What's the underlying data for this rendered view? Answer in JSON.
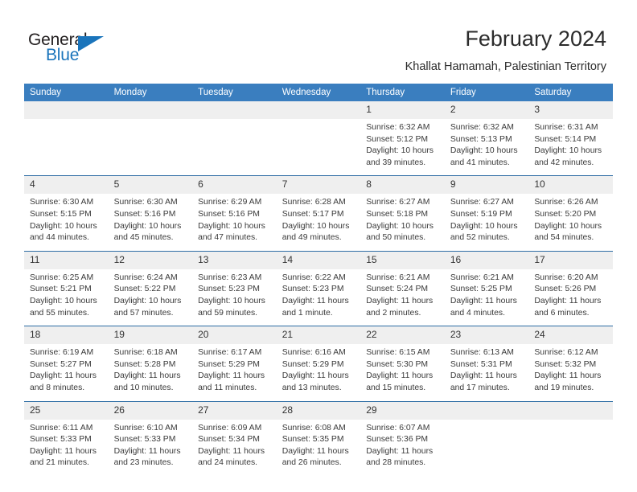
{
  "brand": {
    "name_top": "General",
    "name_bottom": "Blue",
    "triangle_icon": "blue-triangle-icon",
    "color_dark": "#231f20",
    "color_blue": "#1a74bb"
  },
  "header": {
    "month_year": "February 2024",
    "location": "Khallat Hamamah, Palestinian Territory"
  },
  "theme": {
    "header_blue": "#3a7ebf",
    "row_divider_blue": "#2e6da4",
    "daynum_gray": "#efefef",
    "text": "#3a3a3a"
  },
  "weekday_headers": [
    "Sunday",
    "Monday",
    "Tuesday",
    "Wednesday",
    "Thursday",
    "Friday",
    "Saturday"
  ],
  "labels": {
    "sunrise_prefix": "Sunrise:",
    "sunset_prefix": "Sunset:",
    "daylight_prefix": "Daylight:"
  },
  "weeks": [
    [
      {
        "day": "",
        "empty": true,
        "line1": "",
        "line2": "",
        "line3": "",
        "line4": ""
      },
      {
        "day": "",
        "empty": true,
        "line1": "",
        "line2": "",
        "line3": "",
        "line4": ""
      },
      {
        "day": "",
        "empty": true,
        "line1": "",
        "line2": "",
        "line3": "",
        "line4": ""
      },
      {
        "day": "",
        "empty": true,
        "line1": "",
        "line2": "",
        "line3": "",
        "line4": ""
      },
      {
        "day": "1",
        "empty": false,
        "line1": "Sunrise: 6:32 AM",
        "line2": "Sunset: 5:12 PM",
        "line3": "Daylight: 10 hours",
        "line4": "and 39 minutes."
      },
      {
        "day": "2",
        "empty": false,
        "line1": "Sunrise: 6:32 AM",
        "line2": "Sunset: 5:13 PM",
        "line3": "Daylight: 10 hours",
        "line4": "and 41 minutes."
      },
      {
        "day": "3",
        "empty": false,
        "line1": "Sunrise: 6:31 AM",
        "line2": "Sunset: 5:14 PM",
        "line3": "Daylight: 10 hours",
        "line4": "and 42 minutes."
      }
    ],
    [
      {
        "day": "4",
        "empty": false,
        "line1": "Sunrise: 6:30 AM",
        "line2": "Sunset: 5:15 PM",
        "line3": "Daylight: 10 hours",
        "line4": "and 44 minutes."
      },
      {
        "day": "5",
        "empty": false,
        "line1": "Sunrise: 6:30 AM",
        "line2": "Sunset: 5:16 PM",
        "line3": "Daylight: 10 hours",
        "line4": "and 45 minutes."
      },
      {
        "day": "6",
        "empty": false,
        "line1": "Sunrise: 6:29 AM",
        "line2": "Sunset: 5:16 PM",
        "line3": "Daylight: 10 hours",
        "line4": "and 47 minutes."
      },
      {
        "day": "7",
        "empty": false,
        "line1": "Sunrise: 6:28 AM",
        "line2": "Sunset: 5:17 PM",
        "line3": "Daylight: 10 hours",
        "line4": "and 49 minutes."
      },
      {
        "day": "8",
        "empty": false,
        "line1": "Sunrise: 6:27 AM",
        "line2": "Sunset: 5:18 PM",
        "line3": "Daylight: 10 hours",
        "line4": "and 50 minutes."
      },
      {
        "day": "9",
        "empty": false,
        "line1": "Sunrise: 6:27 AM",
        "line2": "Sunset: 5:19 PM",
        "line3": "Daylight: 10 hours",
        "line4": "and 52 minutes."
      },
      {
        "day": "10",
        "empty": false,
        "line1": "Sunrise: 6:26 AM",
        "line2": "Sunset: 5:20 PM",
        "line3": "Daylight: 10 hours",
        "line4": "and 54 minutes."
      }
    ],
    [
      {
        "day": "11",
        "empty": false,
        "line1": "Sunrise: 6:25 AM",
        "line2": "Sunset: 5:21 PM",
        "line3": "Daylight: 10 hours",
        "line4": "and 55 minutes."
      },
      {
        "day": "12",
        "empty": false,
        "line1": "Sunrise: 6:24 AM",
        "line2": "Sunset: 5:22 PM",
        "line3": "Daylight: 10 hours",
        "line4": "and 57 minutes."
      },
      {
        "day": "13",
        "empty": false,
        "line1": "Sunrise: 6:23 AM",
        "line2": "Sunset: 5:23 PM",
        "line3": "Daylight: 10 hours",
        "line4": "and 59 minutes."
      },
      {
        "day": "14",
        "empty": false,
        "line1": "Sunrise: 6:22 AM",
        "line2": "Sunset: 5:23 PM",
        "line3": "Daylight: 11 hours",
        "line4": "and 1 minute."
      },
      {
        "day": "15",
        "empty": false,
        "line1": "Sunrise: 6:21 AM",
        "line2": "Sunset: 5:24 PM",
        "line3": "Daylight: 11 hours",
        "line4": "and 2 minutes."
      },
      {
        "day": "16",
        "empty": false,
        "line1": "Sunrise: 6:21 AM",
        "line2": "Sunset: 5:25 PM",
        "line3": "Daylight: 11 hours",
        "line4": "and 4 minutes."
      },
      {
        "day": "17",
        "empty": false,
        "line1": "Sunrise: 6:20 AM",
        "line2": "Sunset: 5:26 PM",
        "line3": "Daylight: 11 hours",
        "line4": "and 6 minutes."
      }
    ],
    [
      {
        "day": "18",
        "empty": false,
        "line1": "Sunrise: 6:19 AM",
        "line2": "Sunset: 5:27 PM",
        "line3": "Daylight: 11 hours",
        "line4": "and 8 minutes."
      },
      {
        "day": "19",
        "empty": false,
        "line1": "Sunrise: 6:18 AM",
        "line2": "Sunset: 5:28 PM",
        "line3": "Daylight: 11 hours",
        "line4": "and 10 minutes."
      },
      {
        "day": "20",
        "empty": false,
        "line1": "Sunrise: 6:17 AM",
        "line2": "Sunset: 5:29 PM",
        "line3": "Daylight: 11 hours",
        "line4": "and 11 minutes."
      },
      {
        "day": "21",
        "empty": false,
        "line1": "Sunrise: 6:16 AM",
        "line2": "Sunset: 5:29 PM",
        "line3": "Daylight: 11 hours",
        "line4": "and 13 minutes."
      },
      {
        "day": "22",
        "empty": false,
        "line1": "Sunrise: 6:15 AM",
        "line2": "Sunset: 5:30 PM",
        "line3": "Daylight: 11 hours",
        "line4": "and 15 minutes."
      },
      {
        "day": "23",
        "empty": false,
        "line1": "Sunrise: 6:13 AM",
        "line2": "Sunset: 5:31 PM",
        "line3": "Daylight: 11 hours",
        "line4": "and 17 minutes."
      },
      {
        "day": "24",
        "empty": false,
        "line1": "Sunrise: 6:12 AM",
        "line2": "Sunset: 5:32 PM",
        "line3": "Daylight: 11 hours",
        "line4": "and 19 minutes."
      }
    ],
    [
      {
        "day": "25",
        "empty": false,
        "line1": "Sunrise: 6:11 AM",
        "line2": "Sunset: 5:33 PM",
        "line3": "Daylight: 11 hours",
        "line4": "and 21 minutes."
      },
      {
        "day": "26",
        "empty": false,
        "line1": "Sunrise: 6:10 AM",
        "line2": "Sunset: 5:33 PM",
        "line3": "Daylight: 11 hours",
        "line4": "and 23 minutes."
      },
      {
        "day": "27",
        "empty": false,
        "line1": "Sunrise: 6:09 AM",
        "line2": "Sunset: 5:34 PM",
        "line3": "Daylight: 11 hours",
        "line4": "and 24 minutes."
      },
      {
        "day": "28",
        "empty": false,
        "line1": "Sunrise: 6:08 AM",
        "line2": "Sunset: 5:35 PM",
        "line3": "Daylight: 11 hours",
        "line4": "and 26 minutes."
      },
      {
        "day": "29",
        "empty": false,
        "line1": "Sunrise: 6:07 AM",
        "line2": "Sunset: 5:36 PM",
        "line3": "Daylight: 11 hours",
        "line4": "and 28 minutes."
      },
      {
        "day": "",
        "empty": true,
        "line1": "",
        "line2": "",
        "line3": "",
        "line4": ""
      },
      {
        "day": "",
        "empty": true,
        "line1": "",
        "line2": "",
        "line3": "",
        "line4": ""
      }
    ]
  ]
}
